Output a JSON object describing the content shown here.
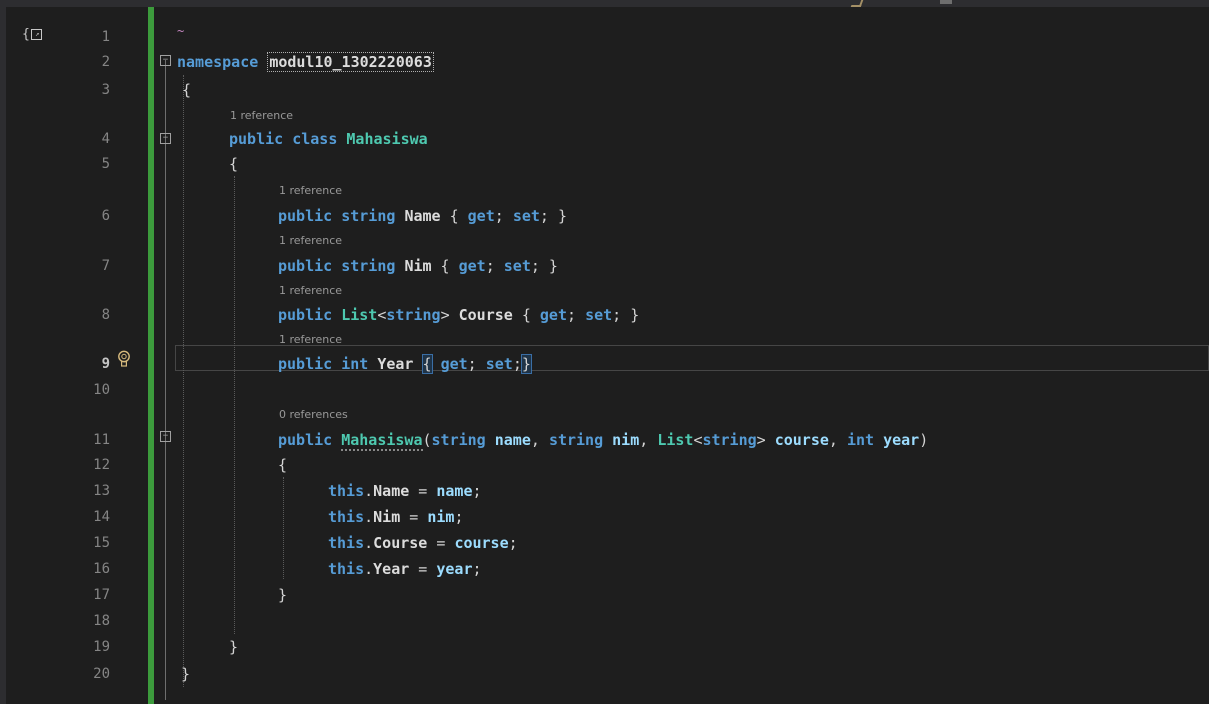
{
  "editor": {
    "lines": [
      {
        "n": "1"
      },
      {
        "n": "2",
        "t": [
          [
            "kw",
            "namespace"
          ],
          [
            "pu",
            " "
          ],
          [
            "ns",
            "modul10_1302220063"
          ]
        ]
      },
      {
        "n": "3",
        "t": [
          [
            "pu",
            "{"
          ]
        ]
      },
      {
        "n": "4",
        "ref": "1 reference",
        "t": [
          [
            "kw",
            "public"
          ],
          [
            "pu",
            " "
          ],
          [
            "kw",
            "class"
          ],
          [
            "pu",
            " "
          ],
          [
            "ty",
            "Mahasiswa"
          ]
        ]
      },
      {
        "n": "5",
        "t": [
          [
            "pu",
            "{"
          ]
        ]
      },
      {
        "n": "6",
        "ref": "1 reference",
        "t": [
          [
            "kw",
            "public"
          ],
          [
            "pu",
            " "
          ],
          [
            "kw",
            "string"
          ],
          [
            "pu",
            " "
          ],
          [
            "id",
            "Name"
          ],
          [
            "pu",
            " { "
          ],
          [
            "kw",
            "get"
          ],
          [
            "pu",
            "; "
          ],
          [
            "kw",
            "set"
          ],
          [
            "pu",
            "; }"
          ]
        ]
      },
      {
        "n": "7",
        "ref": "1 reference",
        "t": [
          [
            "kw",
            "public"
          ],
          [
            "pu",
            " "
          ],
          [
            "kw",
            "string"
          ],
          [
            "pu",
            " "
          ],
          [
            "id",
            "Nim"
          ],
          [
            "pu",
            " { "
          ],
          [
            "kw",
            "get"
          ],
          [
            "pu",
            "; "
          ],
          [
            "kw",
            "set"
          ],
          [
            "pu",
            "; }"
          ]
        ]
      },
      {
        "n": "8",
        "ref": "1 reference",
        "t": [
          [
            "kw",
            "public"
          ],
          [
            "pu",
            " "
          ],
          [
            "ty",
            "List"
          ],
          [
            "pu",
            "<"
          ],
          [
            "kw",
            "string"
          ],
          [
            "pu",
            "> "
          ],
          [
            "id",
            "Course"
          ],
          [
            "pu",
            " { "
          ],
          [
            "kw",
            "get"
          ],
          [
            "pu",
            "; "
          ],
          [
            "kw",
            "set"
          ],
          [
            "pu",
            "; }"
          ]
        ]
      },
      {
        "n": "9",
        "ref": "1 reference",
        "t": [
          [
            "kw",
            "public"
          ],
          [
            "pu",
            " "
          ],
          [
            "kw",
            "int"
          ],
          [
            "pu",
            " "
          ],
          [
            "id",
            "Year"
          ],
          [
            "pu",
            " "
          ],
          [
            "hl",
            "{"
          ],
          [
            "pu",
            " "
          ],
          [
            "kw",
            "get"
          ],
          [
            "pu",
            "; "
          ],
          [
            "kw",
            "set"
          ],
          [
            "pu",
            ";"
          ],
          [
            "hl",
            "}"
          ]
        ]
      },
      {
        "n": "10"
      },
      {
        "n": "11",
        "ref": "0 references",
        "t": [
          [
            "kw",
            "public"
          ],
          [
            "pu",
            " "
          ],
          [
            "ty",
            "Mahasiswa"
          ],
          [
            "pu",
            "("
          ],
          [
            "kw",
            "string"
          ],
          [
            "pu",
            " "
          ],
          [
            "pa",
            "name"
          ],
          [
            "pu",
            ", "
          ],
          [
            "kw",
            "string"
          ],
          [
            "pu",
            " "
          ],
          [
            "pa",
            "nim"
          ],
          [
            "pu",
            ", "
          ],
          [
            "ty",
            "List"
          ],
          [
            "pu",
            "<"
          ],
          [
            "kw",
            "string"
          ],
          [
            "pu",
            "> "
          ],
          [
            "pa",
            "course"
          ],
          [
            "pu",
            ", "
          ],
          [
            "kw",
            "int"
          ],
          [
            "pu",
            " "
          ],
          [
            "pa",
            "year"
          ],
          [
            "pu",
            ")"
          ]
        ]
      },
      {
        "n": "12",
        "t": [
          [
            "pu",
            "{"
          ]
        ]
      },
      {
        "n": "13",
        "t": [
          [
            "kw",
            "this"
          ],
          [
            "pu",
            "."
          ],
          [
            "id",
            "Name"
          ],
          [
            "pu",
            " = "
          ],
          [
            "pa",
            "name"
          ],
          [
            "pu",
            ";"
          ]
        ]
      },
      {
        "n": "14",
        "t": [
          [
            "kw",
            "this"
          ],
          [
            "pu",
            "."
          ],
          [
            "id",
            "Nim"
          ],
          [
            "pu",
            " = "
          ],
          [
            "pa",
            "nim"
          ],
          [
            "pu",
            ";"
          ]
        ]
      },
      {
        "n": "15",
        "t": [
          [
            "kw",
            "this"
          ],
          [
            "pu",
            "."
          ],
          [
            "id",
            "Course"
          ],
          [
            "pu",
            " = "
          ],
          [
            "pa",
            "course"
          ],
          [
            "pu",
            ";"
          ]
        ]
      },
      {
        "n": "16",
        "t": [
          [
            "kw",
            "this"
          ],
          [
            "pu",
            "."
          ],
          [
            "id",
            "Year"
          ],
          [
            "pu",
            " = "
          ],
          [
            "pa",
            "year"
          ],
          [
            "pu",
            ";"
          ]
        ]
      },
      {
        "n": "17",
        "t": [
          [
            "pu",
            "}"
          ]
        ]
      },
      {
        "n": "18"
      },
      {
        "n": "19",
        "t": [
          [
            "pu",
            "}"
          ]
        ]
      },
      {
        "n": "20",
        "t": [
          [
            "pu",
            "}"
          ]
        ]
      }
    ],
    "active_line": "9",
    "colors": {
      "keyword": "#569cd6",
      "type": "#4ec9b0",
      "parameter": "#9cdcfe",
      "identifier": "#dcdcdc",
      "change_bar": "#3c9b3c"
    },
    "icons": {
      "scope": "scope-braces-icon",
      "lightbulb": "lightbulb-icon",
      "collapse": "collapse-icon"
    }
  }
}
